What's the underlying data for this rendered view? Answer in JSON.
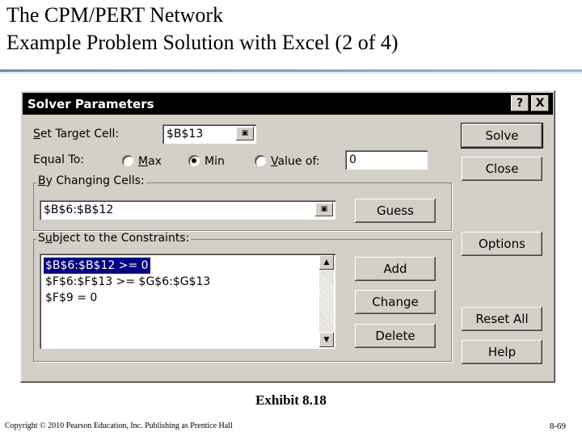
{
  "slide": {
    "title_line1": "The CPM/PERT Network",
    "title_line2": "Example Problem Solution with Excel (2 of 4)",
    "caption": "Exhibit 8.18",
    "copyright": "Copyright © 2010 Pearson Education, Inc. Publishing as Prentice Hall",
    "page_number": "8-69"
  },
  "dialog": {
    "title": "Solver Parameters",
    "help_button": "?",
    "close_button": "X",
    "target_cell": {
      "label_underline": "S",
      "label_rest": "et Target Cell:",
      "value": "$B$13"
    },
    "equal_to": {
      "label": "Equal To:",
      "options": [
        {
          "underline": "M",
          "rest": "ax",
          "selected": false
        },
        {
          "underline": "",
          "rest": "Min",
          "selected": true
        },
        {
          "underline": "V",
          "rest": "alue of:",
          "selected": false
        }
      ],
      "value_of": "0"
    },
    "changing_cells": {
      "label_underline": "B",
      "label_rest": "y Changing Cells:",
      "value": "$B$6:$B$12"
    },
    "constraints": {
      "label_underline": "u",
      "label_prefix": "S",
      "label_rest": "bject to the Constraints:",
      "items": [
        "$B$6:$B$12 >= 0",
        "$F$6:$F$13 >= $G$6:$G$13",
        "$F$9 = 0"
      ],
      "selected_index": 0
    },
    "buttons": {
      "solve": "Solve",
      "close": "Close",
      "guess": "Guess",
      "options": "Options",
      "add": "Add",
      "change": "Change",
      "delete": "Delete",
      "reset_all": "Reset All",
      "help": "Help"
    }
  }
}
